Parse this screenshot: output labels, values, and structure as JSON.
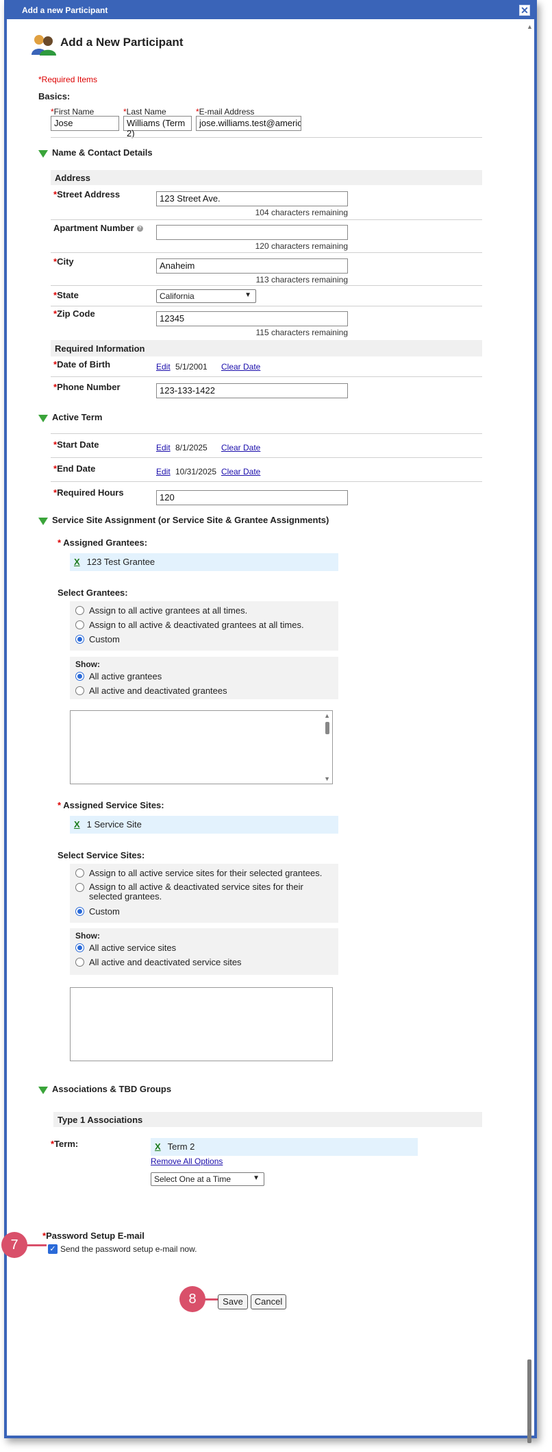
{
  "window": {
    "title": "Add a new Participant",
    "close": "✕"
  },
  "page": {
    "heading": "Add a New Participant",
    "required_note": "*Required Items"
  },
  "basics": {
    "title": "Basics:",
    "first_name": {
      "label": "First Name",
      "value": "Jose"
    },
    "last_name": {
      "label": "Last Name",
      "value": "Williams (Term 2)"
    },
    "email": {
      "label": "E-mail Address",
      "value": "jose.williams.test@america"
    }
  },
  "contact": {
    "title": "Name & Contact Details",
    "address_bar": "Address",
    "street": {
      "label": "Street Address",
      "value": "123 Street Ave.",
      "remaining": "104 characters remaining"
    },
    "apartment": {
      "label": "Apartment Number",
      "value": "",
      "remaining": "120 characters remaining"
    },
    "city": {
      "label": "City",
      "value": "Anaheim",
      "remaining": "113 characters remaining"
    },
    "state": {
      "label": "State",
      "value": "California"
    },
    "zip": {
      "label": "Zip Code",
      "value": "12345",
      "remaining": "115 characters remaining"
    },
    "required_bar": "Required Information",
    "dob": {
      "label": "Date of Birth",
      "edit": "Edit",
      "value": "5/1/2001",
      "clear": "Clear Date"
    },
    "phone": {
      "label": "Phone Number",
      "value": "123-133-1422"
    }
  },
  "term": {
    "title": "Active Term",
    "start": {
      "label": "Start Date",
      "edit": "Edit",
      "value": "8/1/2025",
      "clear": "Clear Date"
    },
    "end": {
      "label": "End Date",
      "edit": "Edit",
      "value": "10/31/2025",
      "clear": "Clear Date"
    },
    "hours": {
      "label": "Required Hours",
      "value": "120"
    }
  },
  "service": {
    "title": "Service Site Assignment (or Service Site & Grantee Assignments)",
    "assigned_grantees_label": "Assigned Grantees:",
    "grantee_tag": "123 Test Grantee",
    "select_grantees_label": "Select Grantees:",
    "grantee_options": [
      "Assign to all active grantees at all times.",
      "Assign to all active & deactivated grantees at all times.",
      "Custom"
    ],
    "show_label": "Show:",
    "grantee_show_options": [
      "All active grantees",
      "All active and deactivated grantees"
    ],
    "assigned_sites_label": "Assigned Service Sites:",
    "site_tag": "1 Service Site",
    "select_sites_label": "Select Service Sites:",
    "site_options": [
      "Assign to all active service sites for their selected grantees.",
      "Assign to all active & deactivated service sites for their selected grantees.",
      "Custom"
    ],
    "site_show_options": [
      "All active service sites",
      "All active and deactivated service sites"
    ],
    "remove_x": "X"
  },
  "assoc": {
    "title": "Associations & TBD Groups",
    "type_bar": "Type 1 Associations",
    "term_label": "Term:",
    "term_tag": "Term 2",
    "remove_all": "Remove All Options",
    "select_placeholder": "Select One at a Time"
  },
  "password": {
    "label": "Password Setup E-mail",
    "checkbox_label": "Send the password setup e-mail now."
  },
  "actions": {
    "save": "Save",
    "cancel": "Cancel"
  },
  "callouts": {
    "c7": "7",
    "c8": "8"
  },
  "colors": {
    "accent": "#3a64b8",
    "callout": "#d9506a",
    "tag_bg": "#e3f2fd",
    "triangle": "#3aa43a"
  }
}
